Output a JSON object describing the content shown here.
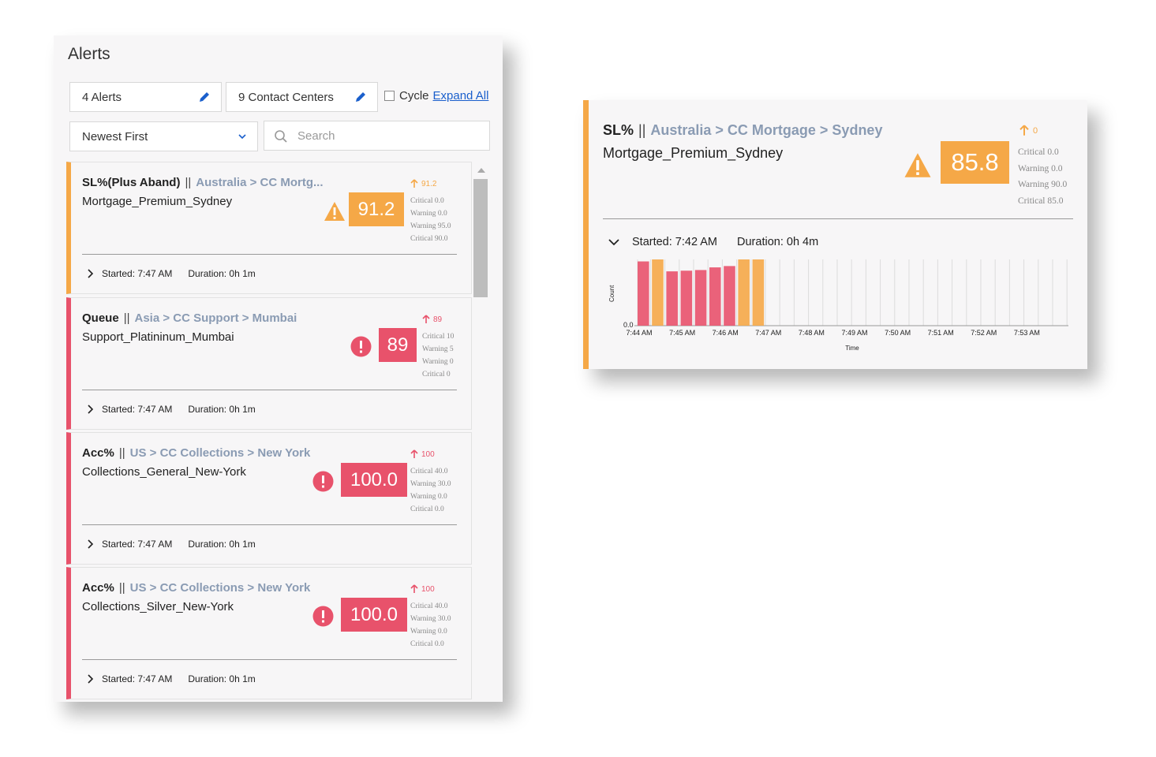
{
  "panel": {
    "title": "Alerts",
    "alerts_filter": "4 Alerts",
    "centers_filter": "9 Contact Centers",
    "cycle_label": "Cycle",
    "expand_all": "Expand All",
    "sort_value": "Newest First",
    "search_placeholder": "Search"
  },
  "cards": [
    {
      "severity": "warn",
      "metric": "SL%(Plus Aband)",
      "sep": "||",
      "path": "Australia > CC Mortg...",
      "name": "Mortgage_Premium_Sydney",
      "value": "91.2",
      "trend": "91.2",
      "thresholds": [
        "Critical 0.0",
        "Warning 0.0",
        "Warning 95.0",
        "Critical 90.0"
      ],
      "started": "Started: 7:47 AM",
      "duration": "Duration: 0h 1m"
    },
    {
      "severity": "crit",
      "metric": "Queue",
      "sep": "||",
      "path": "Asia > CC Support > Mumbai",
      "name": "Support_Platininum_Mumbai",
      "value": "89",
      "trend": "89",
      "thresholds": [
        "Critical 10",
        "Warning 5",
        "Warning 0",
        "Critical 0"
      ],
      "started": "Started: 7:47 AM",
      "duration": "Duration: 0h 1m"
    },
    {
      "severity": "crit",
      "metric": "Acc%",
      "sep": "||",
      "path": "US > CC Collections > New York",
      "name": "Collections_General_New-York",
      "value": "100.0",
      "trend": "100",
      "thresholds": [
        "Critical 40.0",
        "Warning 30.0",
        "Warning 0.0",
        "Critical 0.0"
      ],
      "started": "Started: 7:47 AM",
      "duration": "Duration: 0h 1m"
    },
    {
      "severity": "crit",
      "metric": "Acc%",
      "sep": "||",
      "path": "US > CC Collections > New York",
      "name": "Collections_Silver_New-York",
      "value": "100.0",
      "trend": "100",
      "thresholds": [
        "Critical 40.0",
        "Warning 30.0",
        "Warning 0.0",
        "Critical 0.0"
      ],
      "started": "Started: 7:47 AM",
      "duration": "Duration: 0h 1m"
    }
  ],
  "detail": {
    "metric": "SL%",
    "sep": "||",
    "path": "Australia > CC Mortgage > Sydney",
    "name": "Mortgage_Premium_Sydney",
    "value": "85.8",
    "trend": "0",
    "thresholds": [
      "Critical 0.0",
      "Warning 0.0",
      "Warning 90.0",
      "Critical 85.0"
    ],
    "started": "Started: 7:42 AM",
    "duration": "Duration: 0h 4m"
  },
  "colors": {
    "warning": "#f5a847",
    "critical": "#e8526b",
    "link": "#1a5fcc",
    "path": "#8a9bb3"
  },
  "chart_data": {
    "type": "bar",
    "ylabel": "Count",
    "xlabel": "Time",
    "y_tick_labels": [
      "0.0"
    ],
    "x_tick_labels": [
      "7:44 AM",
      "7:45 AM",
      "7:46 AM",
      "7:47 AM",
      "7:48 AM",
      "7:49 AM",
      "7:50 AM",
      "7:51 AM",
      "7:52 AM",
      "7:53 AM"
    ],
    "ylim": [
      0,
      1
    ],
    "grid": true,
    "bars": [
      {
        "value": 0.97,
        "status": "critical"
      },
      {
        "value": 1.0,
        "status": "warning"
      },
      {
        "value": 0.82,
        "status": "critical"
      },
      {
        "value": 0.83,
        "status": "critical"
      },
      {
        "value": 0.84,
        "status": "critical"
      },
      {
        "value": 0.88,
        "status": "critical"
      },
      {
        "value": 0.9,
        "status": "critical"
      },
      {
        "value": 1.0,
        "status": "warning"
      },
      {
        "value": 1.0,
        "status": "warning"
      },
      {
        "value": 0,
        "status": "none"
      },
      {
        "value": 0,
        "status": "none"
      },
      {
        "value": 0,
        "status": "none"
      },
      {
        "value": 0,
        "status": "none"
      },
      {
        "value": 0,
        "status": "none"
      },
      {
        "value": 0,
        "status": "none"
      },
      {
        "value": 0,
        "status": "none"
      },
      {
        "value": 0,
        "status": "none"
      },
      {
        "value": 0,
        "status": "none"
      },
      {
        "value": 0,
        "status": "none"
      },
      {
        "value": 0,
        "status": "none"
      },
      {
        "value": 0,
        "status": "none"
      },
      {
        "value": 0,
        "status": "none"
      },
      {
        "value": 0,
        "status": "none"
      },
      {
        "value": 0,
        "status": "none"
      },
      {
        "value": 0,
        "status": "none"
      },
      {
        "value": 0,
        "status": "none"
      },
      {
        "value": 0,
        "status": "none"
      },
      {
        "value": 0,
        "status": "none"
      },
      {
        "value": 0,
        "status": "none"
      },
      {
        "value": 0,
        "status": "none"
      }
    ]
  }
}
